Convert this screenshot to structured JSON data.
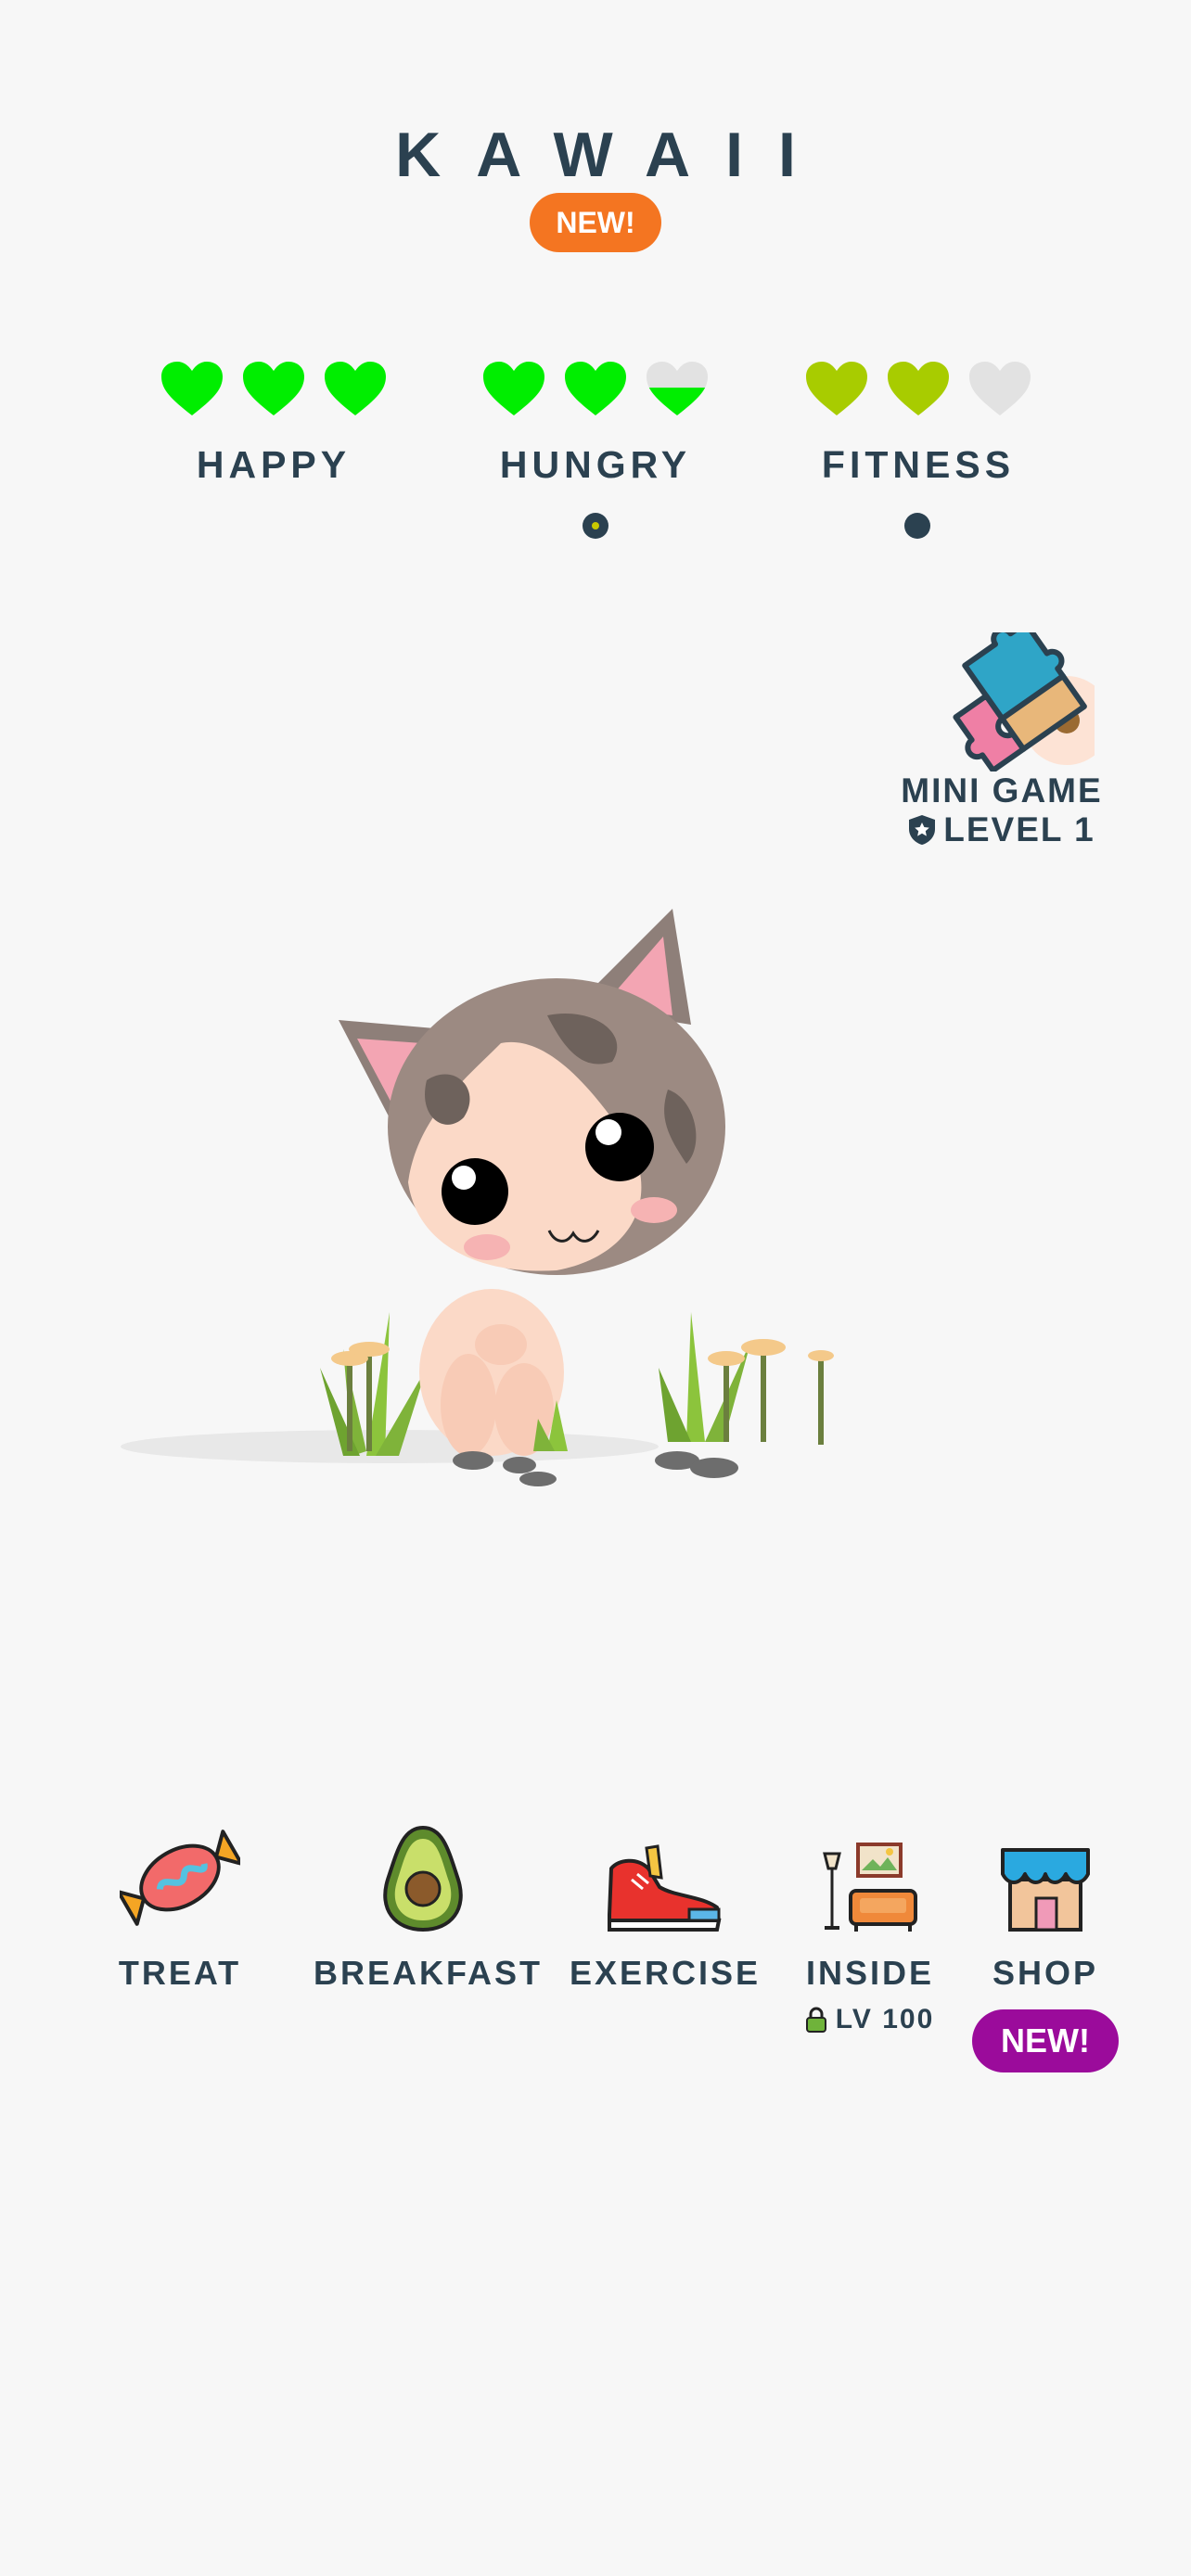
{
  "header": {
    "title": "KAWAII",
    "new_badge": "NEW!"
  },
  "stats": [
    {
      "label": "HAPPY",
      "level": 3.0,
      "max": 3,
      "color": "#00ee00"
    },
    {
      "label": "HUNGRY",
      "level": 2.5,
      "max": 3,
      "color": "#00ee00"
    },
    {
      "label": "FITNESS",
      "level": 2.0,
      "max": 3,
      "color": "#a8cc00"
    }
  ],
  "minigame": {
    "label": "MINI GAME",
    "level": "LEVEL 1"
  },
  "actions": [
    {
      "label": "TREAT",
      "icon": "candy-icon"
    },
    {
      "label": "BREAKFAST",
      "icon": "avocado-icon"
    },
    {
      "label": "EXERCISE",
      "icon": "sneaker-icon"
    },
    {
      "label": "INSIDE",
      "icon": "living-room-icon",
      "lock": "LV 100"
    },
    {
      "label": "SHOP",
      "icon": "shop-icon",
      "badge": "NEW!"
    }
  ],
  "colors": {
    "text": "#2b4150",
    "orange_badge": "#f47521",
    "purple_badge": "#9b0b9b",
    "background": "#f7f7f7"
  }
}
